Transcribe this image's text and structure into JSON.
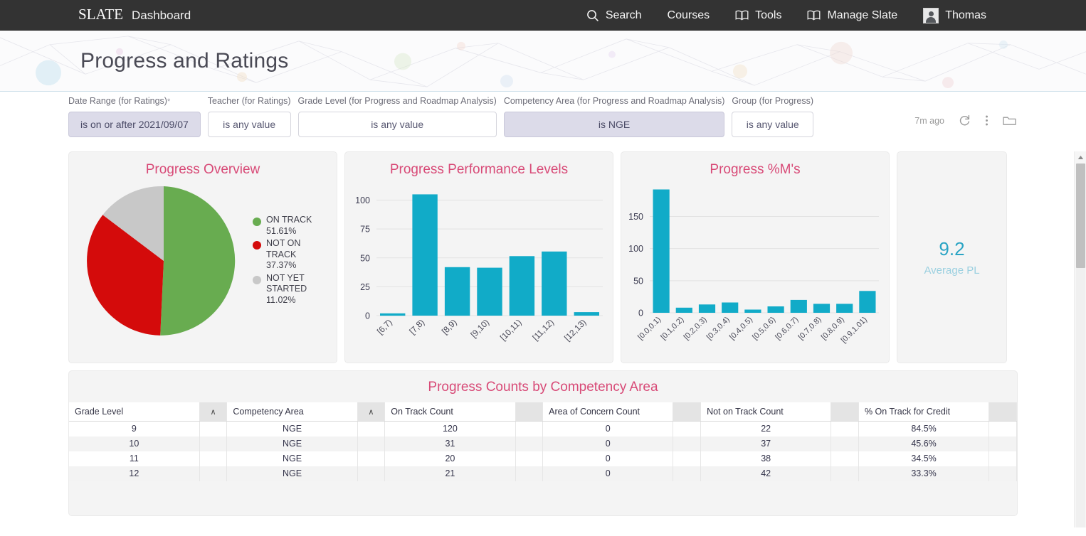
{
  "topnav": {
    "brand_logo": "SLATE",
    "brand_title": "Dashboard",
    "items": [
      {
        "label": "Search",
        "icon": "search-icon"
      },
      {
        "label": "Courses",
        "icon": "none"
      },
      {
        "label": "Tools",
        "icon": "book-icon"
      },
      {
        "label": "Manage Slate",
        "icon": "book-icon"
      },
      {
        "label": "Thomas",
        "icon": "avatar"
      }
    ]
  },
  "banner": {
    "title": "Progress and Ratings"
  },
  "filters": [
    {
      "label": "Date Range (for Ratings)",
      "required": "*",
      "value": "is on or after 2021/09/07",
      "active": true
    },
    {
      "label": "Teacher (for Ratings)",
      "required": "",
      "value": "is any value",
      "active": false
    },
    {
      "label": "Grade Level (for Progress and Roadmap Analysis)",
      "required": "",
      "value": "is any value",
      "active": false
    },
    {
      "label": "Competency Area (for Progress and Roadmap Analysis)",
      "required": "",
      "value": "is NGE",
      "active": true
    },
    {
      "label": "Group (for Progress)",
      "required": "",
      "value": "is any value",
      "active": false
    }
  ],
  "toolbar": {
    "updated_label": "7m ago",
    "refresh_icon": "refresh-icon",
    "more_icon": "kebab-menu-icon",
    "folder_icon": "folder-icon"
  },
  "kpi": {
    "value": "9.2",
    "label": "Average PL"
  },
  "colors": {
    "accent_pink": "#d84a77",
    "teal": "#11abc8",
    "green": "#68ac50",
    "red": "#d40b0b",
    "gray": "#c8c8c8",
    "kpi_blue": "#2aa4c4"
  },
  "chart_data": [
    {
      "type": "pie",
      "title": "Progress Overview",
      "labels": [
        "ON TRACK",
        "NOT ON TRACK",
        "NOT YET STARTED"
      ],
      "values": [
        51.61,
        37.37,
        11.02
      ],
      "value_labels": [
        "51.61%",
        "37.37%",
        "11.02%"
      ],
      "colors": [
        "#68ac50",
        "#d40b0b",
        "#c8c8c8"
      ],
      "legend": "right",
      "grid": false
    },
    {
      "type": "bar",
      "title": "Progress Performance Levels",
      "categories": [
        "[6,7)",
        "[7,8)",
        "[8,9)",
        "[9,10)",
        "[10,11)",
        "[11,12)",
        "[12,13)"
      ],
      "values": [
        2,
        105,
        42,
        41.5,
        51.5,
        55.5,
        3
      ],
      "xlabel": "",
      "ylabel": "",
      "yticks": [
        0,
        25,
        50,
        75,
        100
      ],
      "ylim": [
        0,
        112
      ],
      "color": "#11abc8",
      "grid": true
    },
    {
      "type": "bar",
      "title": "Progress %M's",
      "categories": [
        "[0.0,0.1)",
        "[0.1,0.2)",
        "[0.2,0.3)",
        "[0.3,0.4)",
        "[0.4,0.5)",
        "[0.5,0.6)",
        "[0.6,0.7)",
        "[0.7,0.8)",
        "[0.8,0.9)",
        "[0.9,1.01)"
      ],
      "values": [
        192,
        8,
        13,
        16,
        5,
        10,
        20,
        14,
        14,
        34
      ],
      "xlabel": "",
      "ylabel": "",
      "yticks": [
        0,
        50,
        100,
        150
      ],
      "ylim": [
        0,
        197
      ],
      "color": "#11abc8",
      "grid": true
    }
  ],
  "table": {
    "title": "Progress Counts by Competency Area",
    "columns": [
      "Grade Level",
      "Competency Area",
      "On Track Count",
      "Area of Concern Count",
      "Not on Track Count",
      "% On Track for Credit"
    ],
    "sort_caret": "∧",
    "rows": [
      [
        "9",
        "NGE",
        "120",
        "0",
        "22",
        "84.5%"
      ],
      [
        "10",
        "NGE",
        "31",
        "0",
        "37",
        "45.6%"
      ],
      [
        "11",
        "NGE",
        "20",
        "0",
        "38",
        "34.5%"
      ],
      [
        "12",
        "NGE",
        "21",
        "0",
        "42",
        "33.3%"
      ]
    ]
  }
}
